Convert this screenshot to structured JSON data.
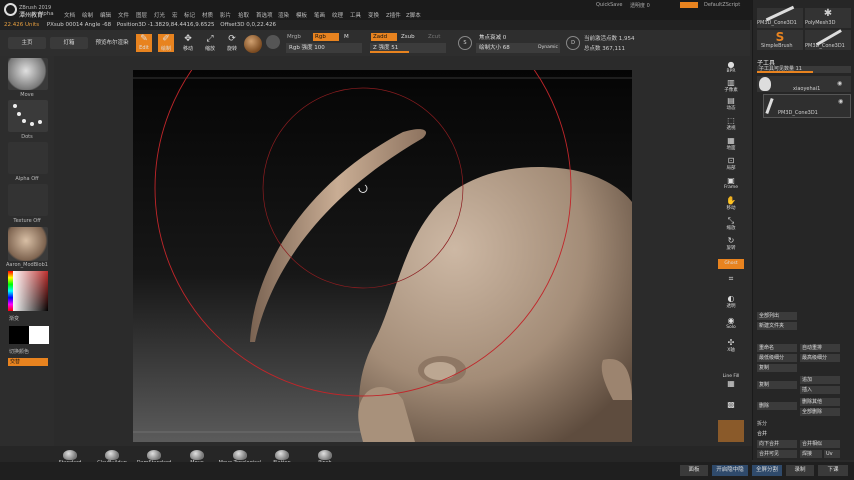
{
  "app": {
    "title": "ZBrush 2019",
    "brand_cn": "潭州教育",
    "brand_en": "TANZHOUEDU",
    "menu": [
      "Alpha",
      "文档",
      "绘制",
      "编辑",
      "文件",
      "图层",
      "灯光",
      "宏",
      "标记",
      "材质",
      "影片",
      "拾取",
      "首选项",
      "渲染",
      "模板",
      "笔画",
      "纹理",
      "工具",
      "变换",
      "Z插件",
      "Z脚本"
    ],
    "quicksave": "QuickSave",
    "see_through": "透明度 0",
    "default_script": "DefaultZScript"
  },
  "info": {
    "units": "22.426 Units",
    "pixol": "PXsub 00014 Angle -68",
    "position": "Position3D  -1.3829,84.4416,9.6525",
    "offset": "Offset3D  0,0,22.426"
  },
  "toolbar": {
    "lightbox": "主页",
    "lightbox2": "灯箱",
    "preview": "预览布尔渲染",
    "edit": "Edit",
    "draw": "绘制",
    "move": "移动",
    "scale": "缩放",
    "rotate": "旋转",
    "mrgb": "Mrgb",
    "rgb": "Rgb",
    "m": "M",
    "rgb_intensity": "Rgb 强度 100",
    "zadd": "Zadd",
    "zsub": "Zsub",
    "zcut": "Zcut",
    "z_intensity": "Z 强度 51",
    "focal_shift": "焦点衰减 0",
    "draw_size": "绘制大小 68",
    "dynamic": "Dynamic",
    "active_points": "当前激活点数 1,954",
    "total_points": "总点数 367,111"
  },
  "left": {
    "brush": "Move",
    "stroke": "Dots",
    "alpha": "Alpha Off",
    "texture": "Texture Off",
    "material": "Aaron_ModBlob1",
    "gradient": "渐变",
    "switch_color": "切换颜色",
    "alternate": "交替"
  },
  "right_strip": [
    "BPR",
    "子像素",
    "动态",
    "透视",
    "地面",
    "局部",
    "Frame",
    "移动",
    "缩放",
    "旋转",
    "线框",
    "显示",
    "透明",
    "Ghost",
    "Solo",
    "X轴",
    "Y轴",
    "Z轴",
    "Line Fill",
    "PolyF",
    "透明",
    "重影"
  ],
  "right_panel": {
    "top_items": [
      "PM3D_Cone3D1",
      "PolyMesh3D",
      "SimpleBrush",
      "PM3D_Cone3D1"
    ],
    "subtool_title": "子工具",
    "subtool_count": "子工具可见数量 11",
    "subtools": [
      "xiaoyehai1",
      "PM3D_Cone3D1"
    ],
    "list_all": "全部列出",
    "new_folder": "新建文件夹",
    "rename": "重命名",
    "auto_reorder": "自动重排",
    "all_low": "最低级细分",
    "all_high": "最高级细分",
    "copy": "复制",
    "add": "追加",
    "insert": "插入",
    "delete": "删除",
    "del_other": "删除其他",
    "del_all": "全部删除",
    "split": "拆分",
    "merge": "合并",
    "merge_down": "向下合并",
    "merge_similar": "合并相似",
    "merge_visible": "合并可见",
    "weld": "焊接",
    "uv": "Uv"
  },
  "bottom_brushes": [
    "Standard",
    "ClayBuildup",
    "DamStandard",
    "Move",
    "Move Topological",
    "Flatten",
    "Pinch"
  ],
  "status": {
    "panel": "面板",
    "open_hide": "开启隐中隐",
    "full_split": "全屏分割",
    "record": "录制",
    "next": "下课"
  },
  "colors": {
    "accent": "#e8831f",
    "menu_bg": "#1b1b1b",
    "canvas_bg": "#2b2b2b",
    "clay": "#b29b86",
    "brush_circle": "#c0262a"
  }
}
